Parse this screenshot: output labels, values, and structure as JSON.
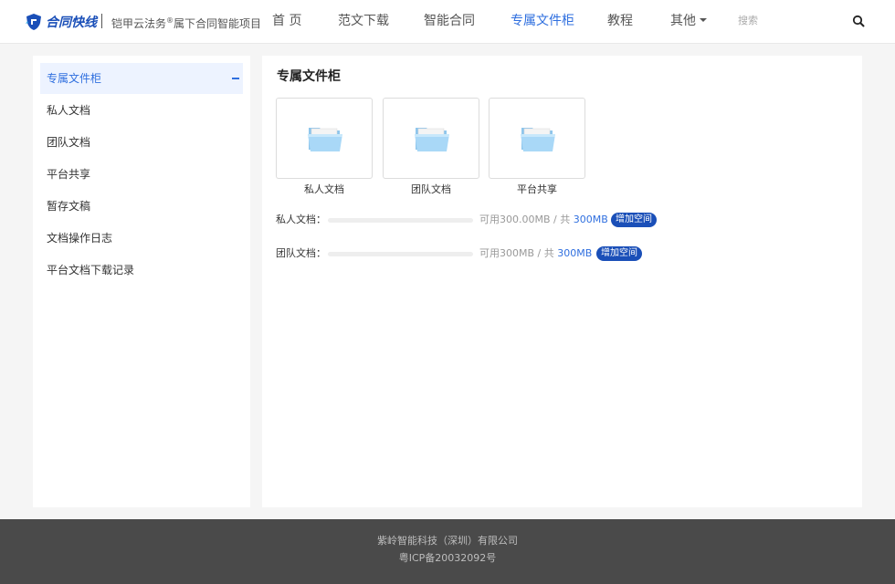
{
  "header": {
    "logo_text": "合同快线",
    "tagline_pre": "铠甲云法务",
    "tagline_reg": "®",
    "tagline_post": "属下合同智能项目",
    "nav": [
      {
        "label": "首 页"
      },
      {
        "label": "范文下载"
      },
      {
        "label": "智能合同"
      },
      {
        "label": "专属文件柜"
      },
      {
        "label": "教程"
      },
      {
        "label": "其他"
      }
    ],
    "search_placeholder": "搜索",
    "active_nav": "专属文件柜",
    "accent_color": "#2f6fdf"
  },
  "sidebar": {
    "items": [
      {
        "label": "专属文件柜"
      },
      {
        "label": "私人文档"
      },
      {
        "label": "团队文档"
      },
      {
        "label": "平台共享"
      },
      {
        "label": "暂存文稿"
      },
      {
        "label": "文档操作日志"
      },
      {
        "label": "平台文档下载记录"
      }
    ],
    "active_item": "专属文件柜"
  },
  "main": {
    "title": "专属文件柜",
    "folders": [
      {
        "label": "私人文档",
        "icon": "folder-icon"
      },
      {
        "label": "团队文档",
        "icon": "folder-icon"
      },
      {
        "label": "平台共享",
        "icon": "folder-icon"
      }
    ],
    "quotas": [
      {
        "label": "私人文档：",
        "available": "可用300.00MB / 共 ",
        "total": "300MB",
        "button": "增加空间",
        "used_fraction": 0
      },
      {
        "label": "团队文档：",
        "available": "可用300MB / 共 ",
        "total": "300MB",
        "button": "增加空间",
        "used_fraction": 0
      }
    ]
  },
  "footer": {
    "company": "紫岭智能科技（深圳）有限公司",
    "icp": "粤ICP备20032092号"
  }
}
